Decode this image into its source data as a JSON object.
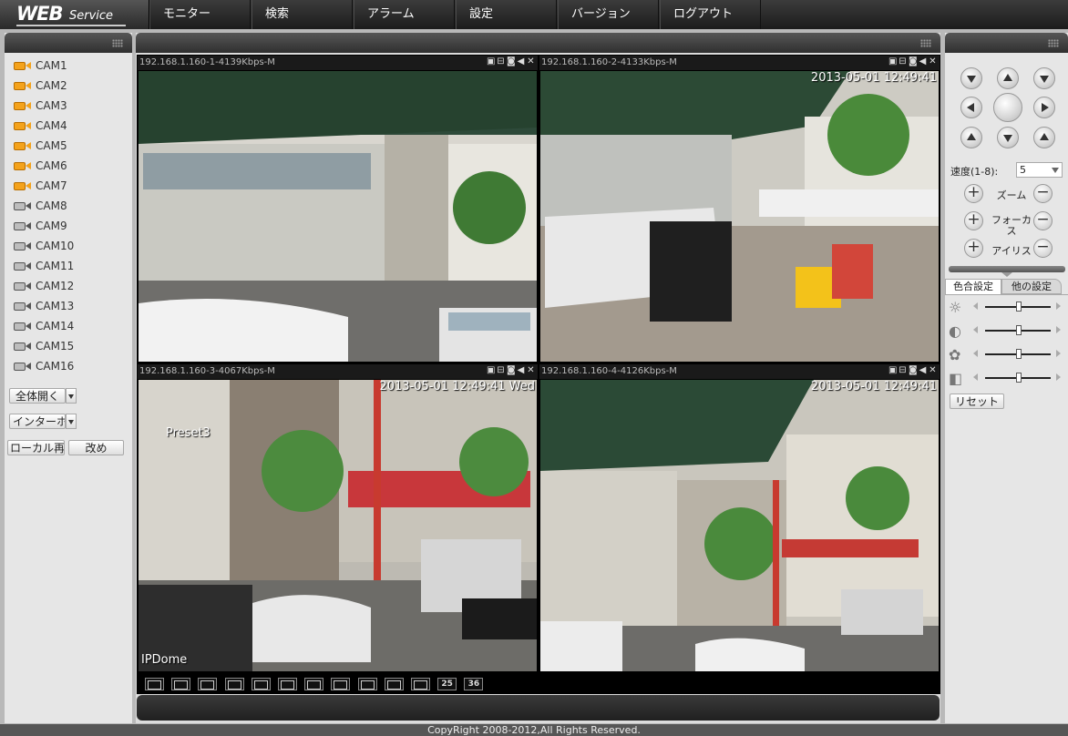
{
  "app": {
    "logo_main": "WEB",
    "logo_sub": "Service"
  },
  "nav": [
    "モニター",
    "検索",
    "アラーム",
    "設定",
    "バージョン",
    "ログアウト"
  ],
  "cameras": [
    {
      "label": "CAM1",
      "active": true
    },
    {
      "label": "CAM2",
      "active": true
    },
    {
      "label": "CAM3",
      "active": true
    },
    {
      "label": "CAM4",
      "active": true
    },
    {
      "label": "CAM5",
      "active": true
    },
    {
      "label": "CAM6",
      "active": true
    },
    {
      "label": "CAM7",
      "active": true
    },
    {
      "label": "CAM8",
      "active": false
    },
    {
      "label": "CAM9",
      "active": false
    },
    {
      "label": "CAM10",
      "active": false
    },
    {
      "label": "CAM11",
      "active": false
    },
    {
      "label": "CAM12",
      "active": false
    },
    {
      "label": "CAM13",
      "active": false
    },
    {
      "label": "CAM14",
      "active": false
    },
    {
      "label": "CAM15",
      "active": false
    },
    {
      "label": "CAM16",
      "active": false
    }
  ],
  "left_controls": {
    "open_all": "全体開く",
    "intercom": "インターホ",
    "local_play": "ローカル再",
    "modify": "改め"
  },
  "panes": [
    {
      "title": "192.168.1.160-1-4139Kbps-M",
      "timestamp": "",
      "overlay_tl": "",
      "overlay_bl": ""
    },
    {
      "title": "192.168.1.160-2-4133Kbps-M",
      "timestamp": "2013-05-01 12:49:41",
      "overlay_tl": "",
      "overlay_bl": ""
    },
    {
      "title": "192.168.1.160-3-4067Kbps-M",
      "timestamp": "2013-05-01 12:49:41 Wed",
      "overlay_tl": "Preset3",
      "overlay_bl": "IPDome"
    },
    {
      "title": "192.168.1.160-4-4126Kbps-M",
      "timestamp": "2013-05-01 12:49:41",
      "overlay_tl": "",
      "overlay_bl": ""
    }
  ],
  "pane_icons": [
    "record-icon",
    "snapshot-icon",
    "camera-icon",
    "audio-icon",
    "close-icon"
  ],
  "layout_buttons": [
    "HD",
    "",
    "",
    "1",
    "4",
    "6",
    "8",
    "9",
    "13",
    "16",
    "20",
    "25",
    "36"
  ],
  "ptz": {
    "speed_label": "速度(1-8):",
    "speed_value": "5",
    "zoom_label": "ズーム",
    "focus_label": "フォーカス",
    "iris_label": "アイリス"
  },
  "tabs": {
    "color": "色合設定",
    "other": "他の設定"
  },
  "color_sliders": [
    {
      "icon": "brightness-icon",
      "value": 0.5
    },
    {
      "icon": "contrast-icon",
      "value": 0.5
    },
    {
      "icon": "saturation-icon",
      "value": 0.5
    },
    {
      "icon": "hue-icon",
      "value": 0.5
    }
  ],
  "reset_label": "リセット",
  "footer": "CopyRight 2008-2012,All Rights Reserved.",
  "colors": {
    "accent_cam": "#f4a21b",
    "bar": "#2f2f2f"
  }
}
